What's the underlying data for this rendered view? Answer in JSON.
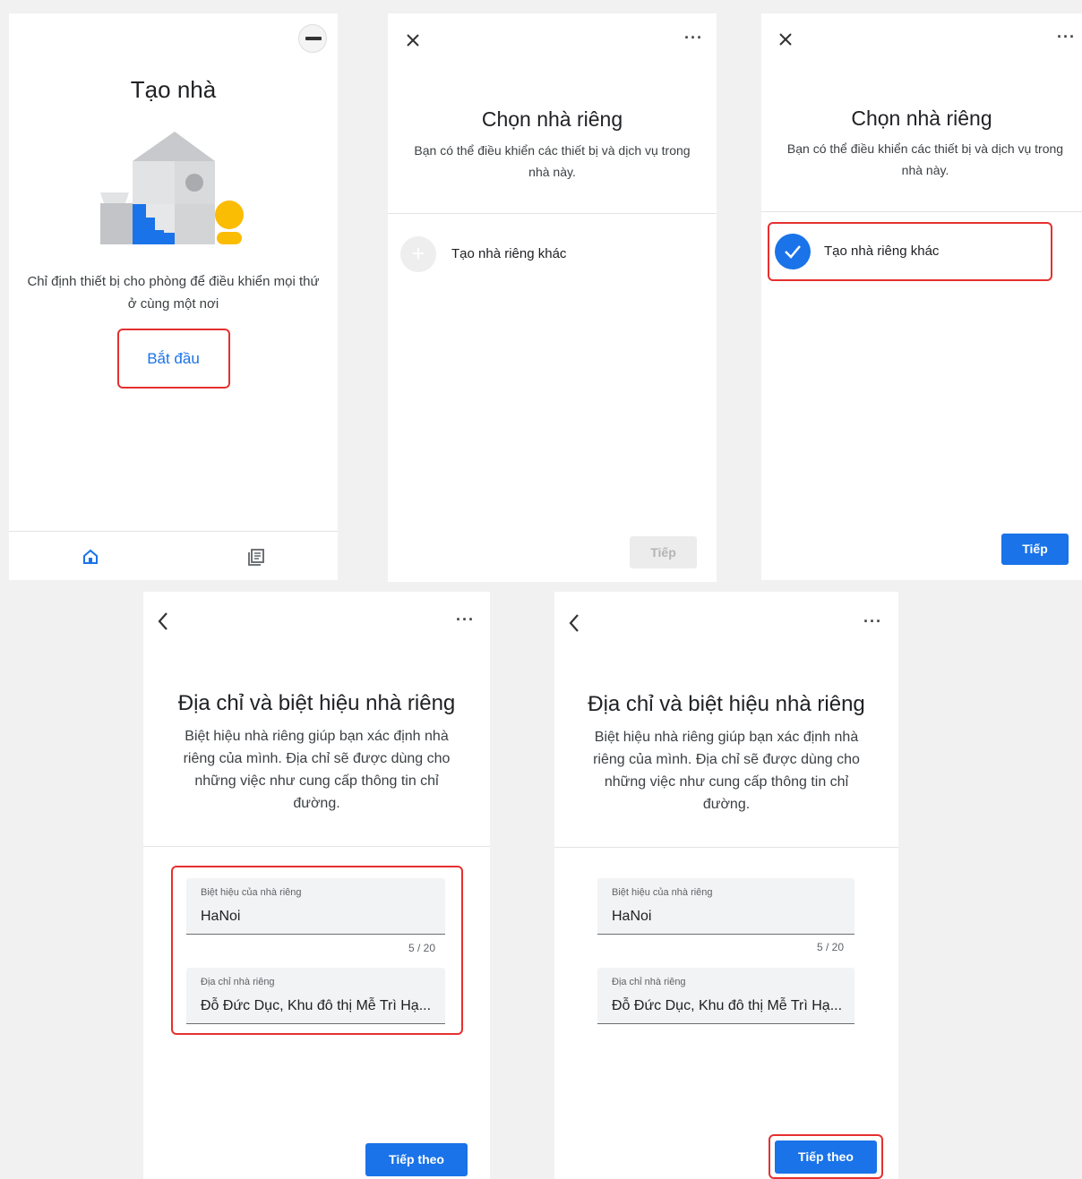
{
  "screens": {
    "create_home": {
      "title": "Tạo nhà",
      "description": "Chỉ định thiết bị cho phòng để điều khiển mọi thứ ở cùng một nơi",
      "start_button": "Bắt đầu",
      "bottom_nav": {
        "home_icon": "home-icon",
        "feed_icon": "feed-icon"
      }
    },
    "choose_home_empty": {
      "title": "Chọn nhà riêng",
      "subtitle": "Bạn có thể điều khiển các thiết bị và dịch vụ trong nhà này.",
      "option_label": "Tạo nhà riêng khác",
      "next_button": "Tiếp",
      "next_enabled": false
    },
    "choose_home_selected": {
      "title": "Chọn nhà riêng",
      "subtitle": "Bạn có thể điều khiển các thiết bị và dịch vụ trong nhà này.",
      "option_label": "Tạo nhà riêng khác",
      "option_selected": true,
      "next_button": "Tiếp",
      "next_enabled": true
    },
    "address_a": {
      "title": "Địa chỉ và biệt hiệu nhà riêng",
      "description": "Biệt hiệu nhà riêng giúp bạn xác định nhà riêng của mình. Địa chỉ sẽ được dùng cho những việc như cung cấp thông tin chỉ đường.",
      "nickname_label": "Biệt hiệu của nhà riêng",
      "nickname_value": "HaNoi",
      "nickname_counter": "5 / 20",
      "address_label": "Địa chỉ nhà riêng",
      "address_value": "Đỗ Đức Dục, Khu đô thị Mễ Trì Hạ...",
      "next_button": "Tiếp theo"
    },
    "address_b": {
      "title": "Địa chỉ và biệt hiệu nhà riêng",
      "description": "Biệt hiệu nhà riêng giúp bạn xác định nhà riêng của mình. Địa chỉ sẽ được dùng cho những việc như cung cấp thông tin chỉ đường.",
      "nickname_label": "Biệt hiệu của nhà riêng",
      "nickname_value": "HaNoi",
      "nickname_counter": "5 / 20",
      "address_label": "Địa chỉ nhà riêng",
      "address_value": "Đỗ Đức Dục, Khu đô thị Mễ Trì Hạ...",
      "next_button": "Tiếp theo"
    }
  },
  "icons": {
    "close": "close-icon",
    "more": "more-icon",
    "back": "back-icon",
    "add": "add-icon",
    "check": "check-icon"
  },
  "colors": {
    "accent": "#1a73e8",
    "highlight": "#e5302f",
    "disabled": "#ececec"
  }
}
